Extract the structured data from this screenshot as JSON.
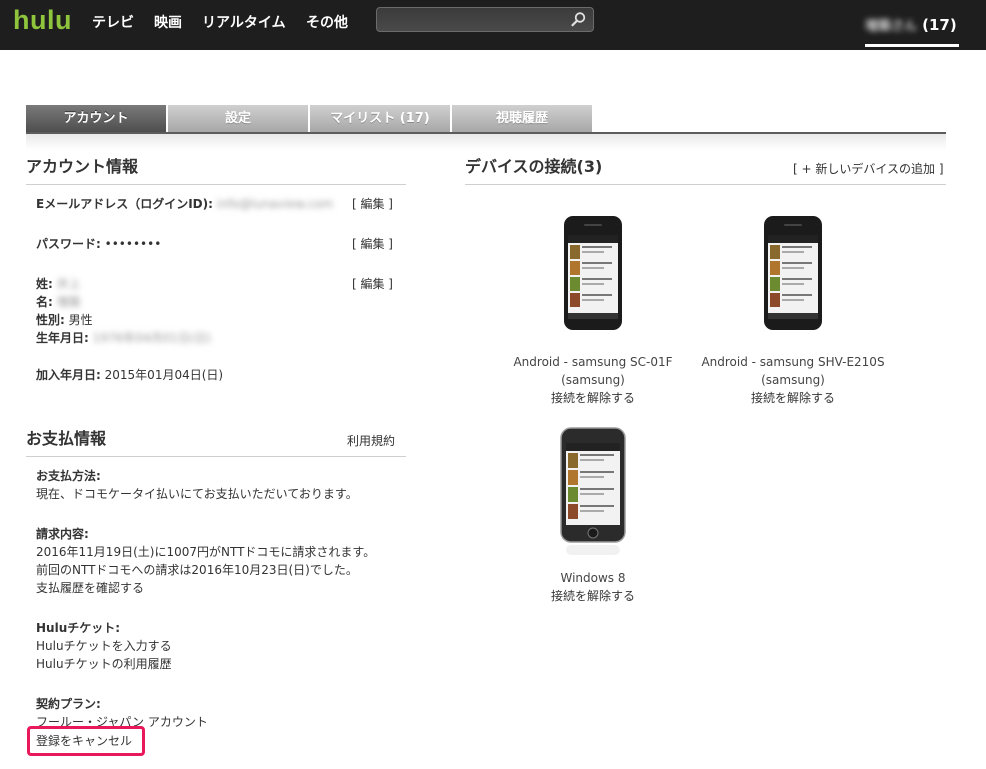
{
  "header": {
    "logo": "hulu",
    "logo_color": "#8fc43d",
    "nav": [
      "テレビ",
      "映画",
      "リアルタイム",
      "その他"
    ],
    "search": {
      "value": "",
      "placeholder": ""
    },
    "user": {
      "name": "増築さん",
      "count": "(17)"
    }
  },
  "tabs": [
    {
      "label": "アカウント",
      "active": true
    },
    {
      "label": "設定",
      "active": false
    },
    {
      "label": "マイリスト (17)",
      "active": false
    },
    {
      "label": "視聴履歴",
      "active": false
    }
  ],
  "account": {
    "title": "アカウント情報",
    "email_label": "Eメールアドレス（ログインID):",
    "email_value": "info@lunaview.com",
    "password_label": "パスワード:",
    "password_value": "••••••••",
    "edit_label": "[ 編集 ]",
    "surname_label": "姓:",
    "surname_value": "井上",
    "given_label": "名:",
    "given_value": "増築",
    "gender_label": "性別:",
    "gender_value": "男性",
    "birth_label": "生年月日:",
    "birth_value": "1976年04月01日(日)",
    "joined_label": "加入年月日:",
    "joined_value": "2015年01月04日(日)"
  },
  "billing": {
    "title": "お支払情報",
    "terms_link": "利用規約",
    "method_label": "お支払方法:",
    "method_text": "現在、ドコモケータイ払いにてお支払いただいております。",
    "invoice_label": "請求内容:",
    "invoice_line1": "2016年11月19日(土)に1007円がNTTドコモに請求されます。",
    "invoice_line2": "前回のNTTドコモへの請求は2016年10月23日(日)でした。",
    "history_link": "支払履歴を確認する",
    "ticket_label": "Huluチケット:",
    "ticket_enter_link": "Huluチケットを入力する",
    "ticket_history_link": "Huluチケットの利用履歴",
    "plan_label": "契約プラン:",
    "plan_value": "フールー・ジャパン アカウント",
    "cancel_link": "登録をキャンセル"
  },
  "devices": {
    "title": "デバイスの接続(3)",
    "add_link": "[ + 新しいデバイスの追加 ]",
    "disconnect_label": "接続を解除する",
    "items": [
      {
        "name": "Android - samsung SC-01F",
        "maker": "(samsung)",
        "icon": "android-phone-icon"
      },
      {
        "name": "Android - samsung SHV-E210S",
        "maker": "(samsung)",
        "icon": "android-phone-icon"
      },
      {
        "name": "Windows 8",
        "maker": "",
        "icon": "ipod-icon"
      }
    ]
  },
  "colors": {
    "link": "#4b73a8",
    "topbar": "#1e1e1e",
    "highlight": "#e8185a"
  }
}
